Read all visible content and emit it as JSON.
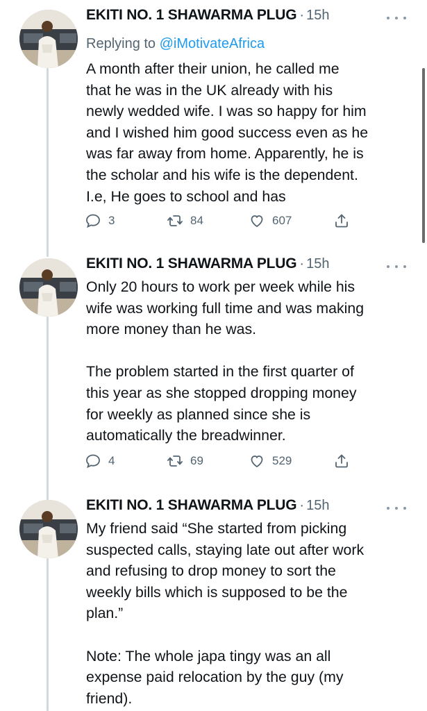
{
  "tweets": [
    {
      "author": "EKITI NO. 1 SHAWARMA PLUG",
      "time": "15h",
      "reply_prefix": "Replying to ",
      "reply_handle": "@iMotivateAfrica",
      "text": "A month after their union, he called me\nthat he was in the UK already with his\nnewly wedded wife. I was so happy for him\nand I wished him good success even as he\nwas far away from home. Apparently, he is\nthe scholar and his wife is the dependent.\nI.e, He goes to school and has",
      "replies": "3",
      "retweets": "84",
      "likes": "607"
    },
    {
      "author": "EKITI NO. 1 SHAWARMA PLUG",
      "time": "15h",
      "text": "Only 20 hours to work per week while his\nwife was working full time and was making\nmore money than he was.\n\nThe problem started in the first quarter of\nthis year as she stopped dropping money\nfor weekly as planned since she is\nautomatically the breadwinner.",
      "replies": "4",
      "retweets": "69",
      "likes": "529"
    },
    {
      "author": "EKITI NO. 1 SHAWARMA PLUG",
      "time": "15h",
      "text": "My friend said “She started from picking\nsuspected calls, staying late out after work\nand refusing to drop money to sort the\nweekly bills which is supposed to be the\nplan.”\n\nNote: The whole japa tingy was an all\nexpense paid relocation by the guy (my\nfriend)."
    }
  ],
  "icons": {
    "reply": "speech-bubble-icon",
    "retweet": "retweet-arrows-icon",
    "like": "heart-outline-icon",
    "share": "share-upload-icon",
    "more": "three-dots-icon"
  },
  "colors": {
    "text": "#0f1419",
    "secondary": "#536471",
    "link": "#1d9bf0",
    "rail": "#cfd9de"
  }
}
